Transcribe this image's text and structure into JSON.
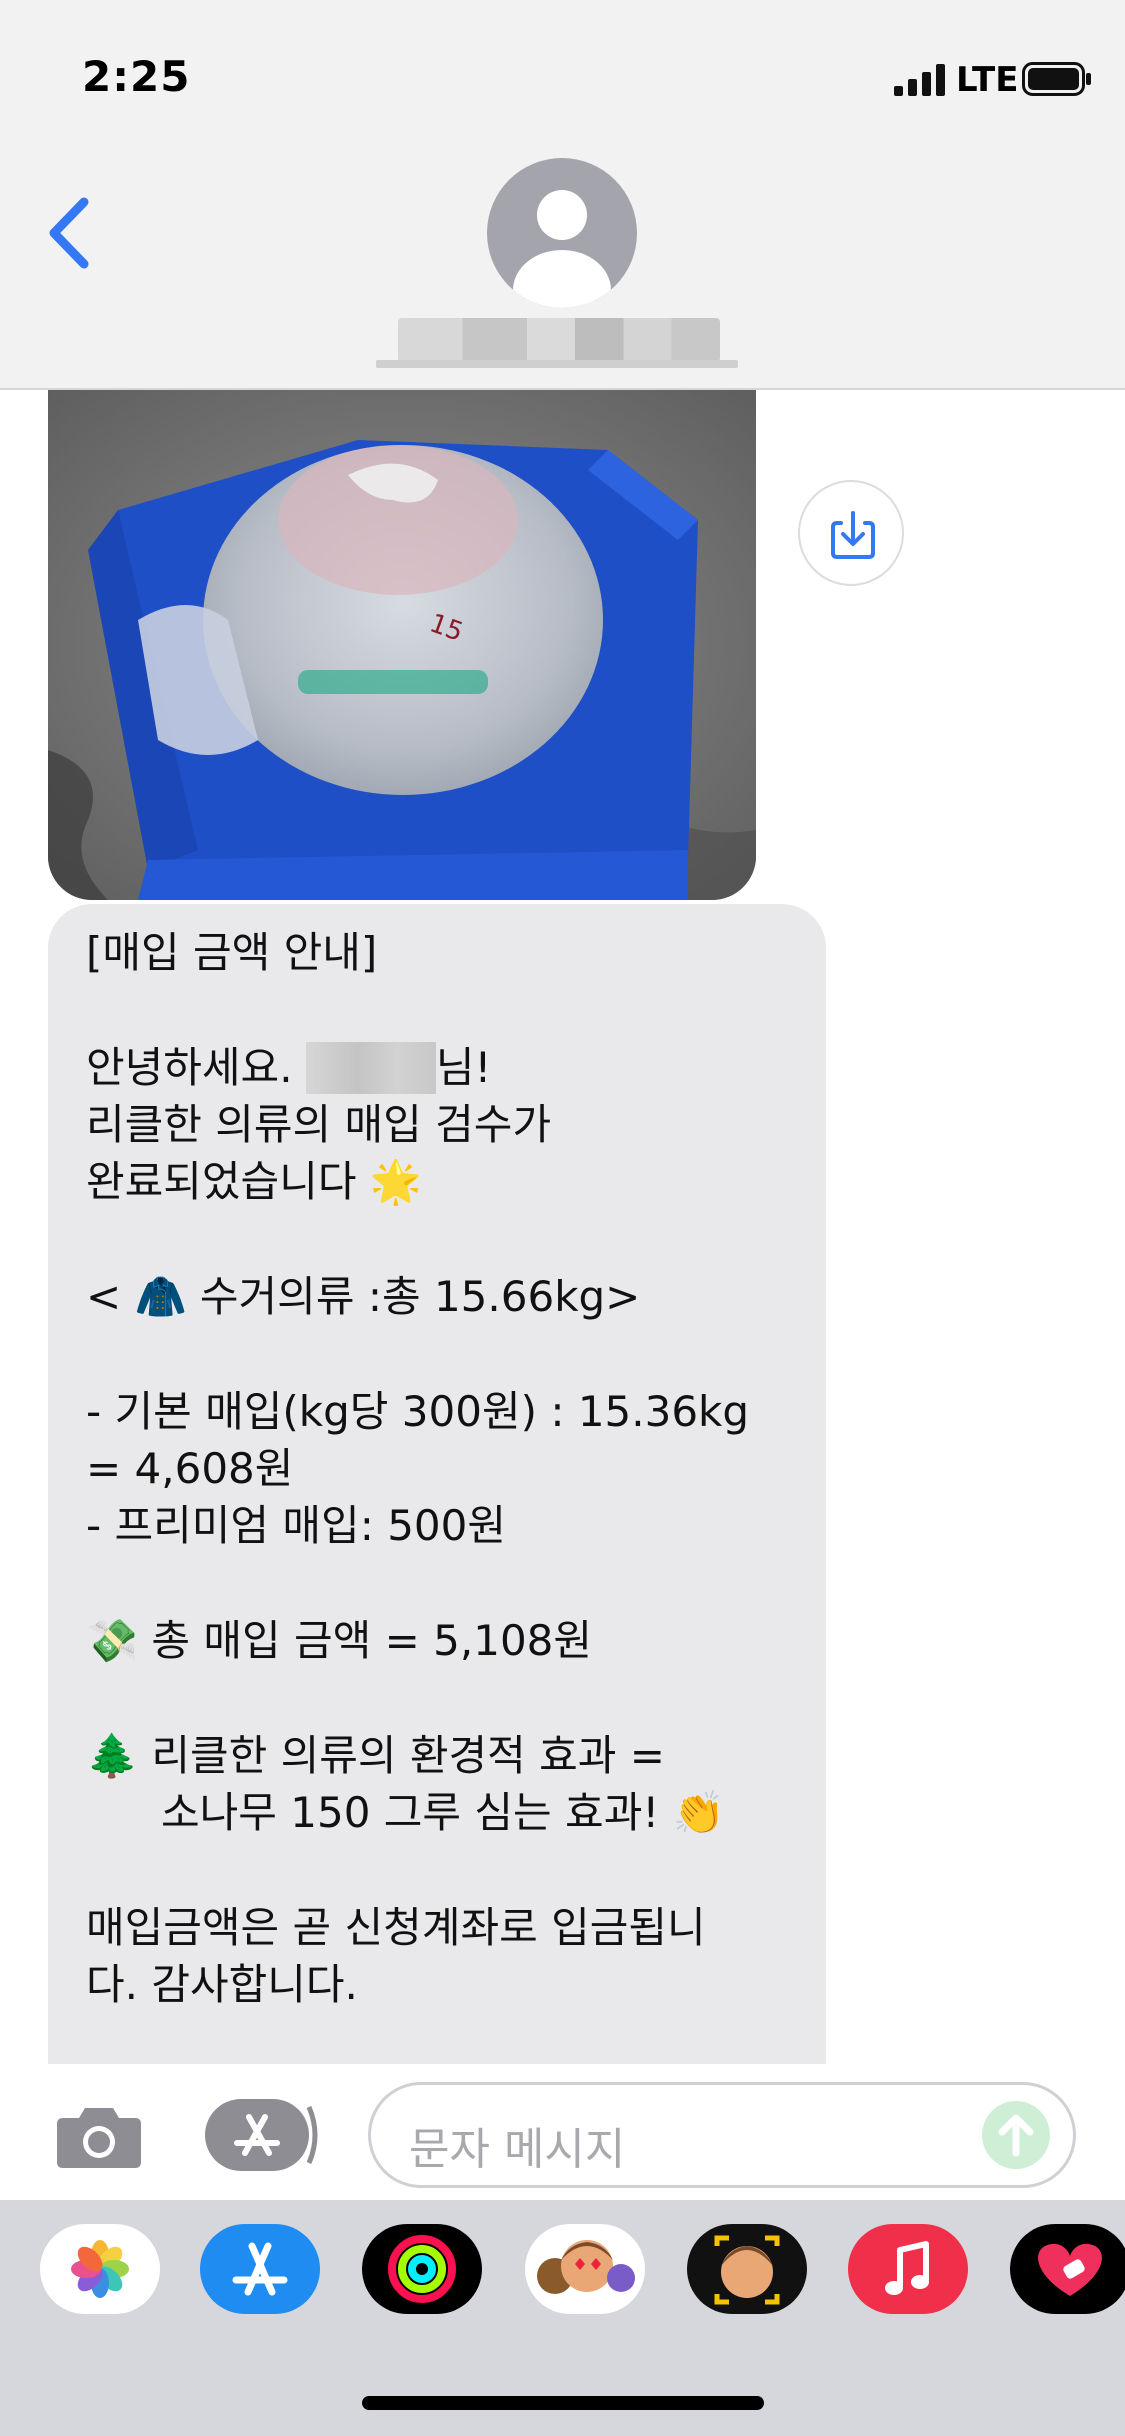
{
  "status_bar": {
    "time": "2:25",
    "network": "LTE"
  },
  "colors": {
    "accent": "#3478f6",
    "bubble_gray": "#e9e9eb",
    "send_green": "#34c759"
  },
  "messages": {
    "title": "[매입 금액 안내]",
    "greeting_pre": "안녕하세요. ",
    "greeting_post": "님!",
    "line2": "리클한 의류의 매입 검수가",
    "line3": "완료되었습니다",
    "summary_pre": "< ",
    "summary_text": "수거의류 :총 15.66kg>",
    "basic1": "- 기본 매입(kg당 300원) : 15.36kg",
    "basic2": "= 4,608원",
    "premium": "- 프리미엄 매입: 500원",
    "total": "총 매입 금액 = 5,108원",
    "eco1": "리클한 의류의 환경적 효과 =",
    "eco2": "소나무 150 그루 심는 효과!",
    "closing1": "매입금액은 곧 신청계좌로 입금됩니",
    "closing2": "다. 감사합니다."
  },
  "input": {
    "placeholder": "문자 메시지"
  },
  "icons": {
    "back": "chevron-left-icon",
    "save": "save-image-icon",
    "camera": "camera-icon",
    "appstore": "appstore-icon",
    "send": "send-arrow-icon"
  },
  "emoji": {
    "sparkle": "🌟",
    "coat": "🧥",
    "money": "💸",
    "tree": "🌲",
    "clap": "👏"
  }
}
